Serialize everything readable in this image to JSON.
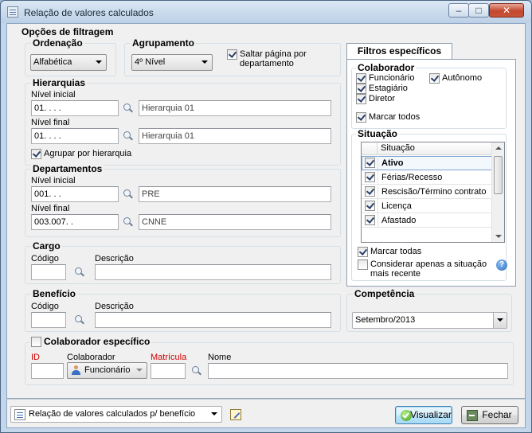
{
  "window": {
    "title": "Relação de valores calculados",
    "controls": {
      "minimize": "–",
      "maximize": "□",
      "close": "✕"
    }
  },
  "filters": {
    "title": "Opções de filtragem",
    "ordenacao": {
      "label": "Ordenação",
      "value": "Alfabética"
    },
    "agrupamento": {
      "label": "Agrupamento",
      "value": "4º Nível"
    },
    "saltar_pagina": {
      "label": "Saltar página por departamento",
      "checked": true
    },
    "hierarquias": {
      "label": "Hierarquias",
      "inicial_label": "Nível inicial",
      "inicial_value": "01.   .   .   .",
      "inicial_desc": "Hierarquia 01",
      "final_label": "Nível final",
      "final_value": "01.   .   .   .",
      "final_desc": "Hierarquia 01",
      "agrupar_label": "Agrupar por hierarquia",
      "agrupar_checked": true
    },
    "departamentos": {
      "label": "Departamentos",
      "inicial_label": "Nível inicial",
      "inicial_value": "001.   .   .",
      "inicial_desc": "PRE",
      "final_label": "Nível final",
      "final_value": "003.007.   .",
      "final_desc": "CNNE"
    },
    "cargo": {
      "label": "Cargo",
      "codigo_label": "Código",
      "descricao_label": "Descrição",
      "codigo": "",
      "descricao": ""
    },
    "beneficio": {
      "label": "Benefício",
      "codigo_label": "Código",
      "descricao_label": "Descrição",
      "codigo": "",
      "descricao": ""
    },
    "colaborador_especifico": {
      "label": "Colaborador específico",
      "checked": false,
      "id_label": "ID",
      "colaborador_label": "Colaborador",
      "colaborador_value": "Funcionário",
      "matricula_label": "Matrícula",
      "nome_label": "Nome",
      "id": "",
      "matricula": "",
      "nome": ""
    }
  },
  "especificos": {
    "tab_label": "Filtros específicos",
    "colaborador": {
      "label": "Colaborador",
      "funcionario": "Funcionário",
      "autonomo": "Autônomo",
      "estagiario": "Estagiário",
      "diretor": "Diretor",
      "marcar_todos": "Marcar todos"
    },
    "situacao": {
      "label": "Situação",
      "column": "Situação",
      "items": [
        {
          "label": "Ativo",
          "checked": true
        },
        {
          "label": "Férias/Recesso",
          "checked": true
        },
        {
          "label": "Rescisão/Término contrato",
          "checked": true
        },
        {
          "label": "Licença",
          "checked": true
        },
        {
          "label": "Afastado",
          "checked": true
        }
      ],
      "marcar_todas": "Marcar todas",
      "considerar": "Considerar apenas a situação mais recente",
      "help": "?"
    }
  },
  "competencia": {
    "label": "Competência",
    "value": "Setembro/2013"
  },
  "footer": {
    "report": "Relação de valores calculados p/ benefício",
    "visualizar": "Visualizar",
    "fechar": "Fechar"
  }
}
